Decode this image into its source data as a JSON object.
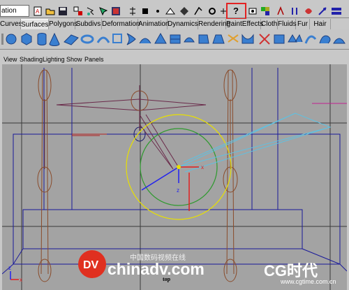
{
  "toolbar": {
    "menu_set": "ation",
    "help_icon": "question-mark-icon"
  },
  "shelf_tabs": [
    {
      "label": "Curves"
    },
    {
      "label": "Surfaces",
      "active": true
    },
    {
      "label": "Polygons"
    },
    {
      "label": "Subdivs"
    },
    {
      "label": "Deformation"
    },
    {
      "label": "Animation"
    },
    {
      "label": "Dynamics"
    },
    {
      "label": "Rendering"
    },
    {
      "label": "PaintEffects"
    },
    {
      "label": "Cloth"
    },
    {
      "label": "Fluids"
    },
    {
      "label": "Fur"
    },
    {
      "label": "Hair"
    }
  ],
  "panel_menu": [
    "View",
    "Shading",
    "Lighting",
    "Show",
    "Panels"
  ],
  "viewport": {
    "camera_label": "top",
    "axis_x": "x",
    "axis_z": "z"
  },
  "watermark": {
    "dv_logo": "DV",
    "site": "chinadv.com",
    "cn_text": "中国数码视频在线",
    "cg_logo": "CG时代",
    "cg_site": "www.cgtime.com.cn"
  },
  "colors": {
    "highlight": "#e32222",
    "viewport_bg": "#a3a3a3",
    "skeleton": "#8a4b2a",
    "wire_blue": "#1a1a9a",
    "circle_yellow": "#e8e000",
    "circle_green": "#2e9a2e"
  }
}
